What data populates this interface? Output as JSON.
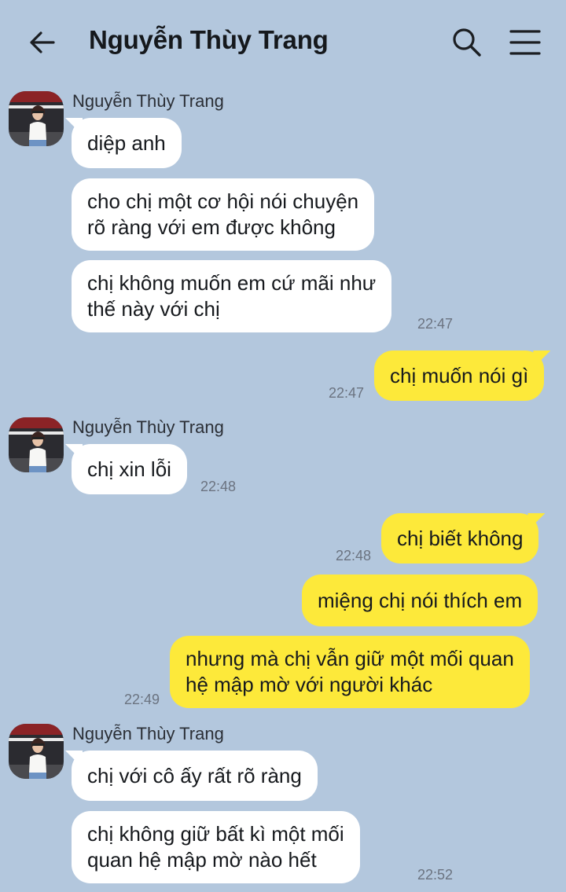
{
  "header": {
    "title": "Nguyễn Thùy Trang",
    "back_icon": "arrow-left-icon",
    "search_icon": "search-icon",
    "menu_icon": "hamburger-menu-icon"
  },
  "colors": {
    "background": "#b3c7dd",
    "incoming_bubble": "#ffffff",
    "outgoing_bubble": "#fde93a"
  },
  "messages": [
    {
      "direction": "in",
      "sender": "Nguyễn Thùy Trang",
      "lines": [
        "diệp anh"
      ]
    },
    {
      "direction": "in",
      "lines": [
        "cho chị một cơ hội nói chuyện",
        "rõ ràng với em được không"
      ]
    },
    {
      "direction": "in",
      "lines": [
        "chị không muốn em cứ mãi như",
        "thế này với chị"
      ],
      "time": "22:47"
    },
    {
      "direction": "out",
      "lines": [
        "chị muốn nói gì"
      ],
      "time": "22:47"
    },
    {
      "direction": "in",
      "sender": "Nguyễn Thùy Trang",
      "lines": [
        "chị xin lỗi"
      ],
      "time": "22:48"
    },
    {
      "direction": "out",
      "lines": [
        "chị biết không"
      ],
      "time": "22:48"
    },
    {
      "direction": "out",
      "lines": [
        "miệng chị nói thích em"
      ]
    },
    {
      "direction": "out",
      "lines": [
        "nhưng mà chị vẫn giữ một mối quan",
        "hệ mập mờ với người khác"
      ],
      "time": "22:49"
    },
    {
      "direction": "in",
      "sender": "Nguyễn Thùy Trang",
      "lines": [
        "chị với cô ấy rất rõ ràng"
      ]
    },
    {
      "direction": "in",
      "lines": [
        "chị không giữ bất kì một mối",
        "quan hệ mập mờ nào hết"
      ],
      "time": "22:52"
    }
  ]
}
